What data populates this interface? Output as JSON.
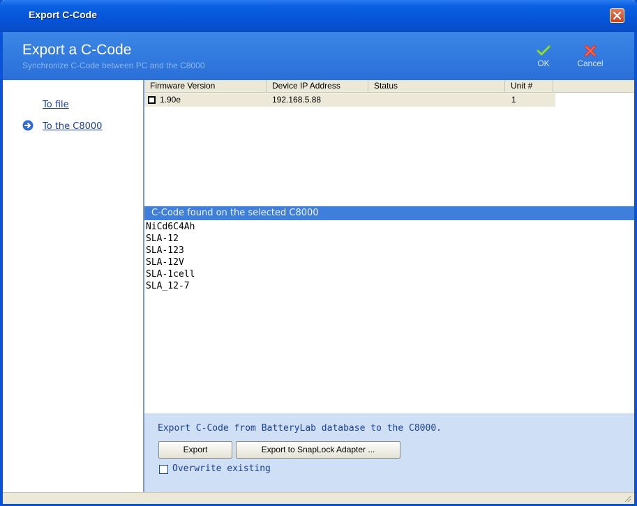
{
  "window": {
    "title": "Export C-Code"
  },
  "header": {
    "title": "Export a C-Code",
    "subtitle": "Synchronize C-Code between PC and the C8000",
    "ok_label": "OK",
    "cancel_label": "Cancel"
  },
  "sidebar": {
    "items": [
      {
        "label": "To file"
      },
      {
        "label": "To the C8000"
      }
    ]
  },
  "device_table": {
    "columns": [
      "Firmware Version",
      "Device IP Address",
      "Status",
      "Unit #"
    ],
    "rows": [
      {
        "firmware": "1.90e",
        "ip": "192.168.5.88",
        "status": "",
        "unit": "1"
      }
    ]
  },
  "ccode": {
    "header": "C-Code found on the selected C8000",
    "items": [
      "NiCd6C4Ah",
      "SLA-12",
      "SLA-123",
      "SLA-12V",
      "SLA-1cell",
      "SLA_12-7"
    ]
  },
  "bottom": {
    "text": "Export C-Code from BatteryLab database to the C8000.",
    "export_label": "Export",
    "snaplock_label": "Export to SnapLock Adapter ...",
    "overwrite_label": "Overwrite existing"
  },
  "colors": {
    "titlebar": "#0454d8",
    "header": "#2a6fd8",
    "section_header": "#3f7fdc",
    "bottom_panel": "#cfe0f6",
    "link": "#1a3fa0"
  }
}
